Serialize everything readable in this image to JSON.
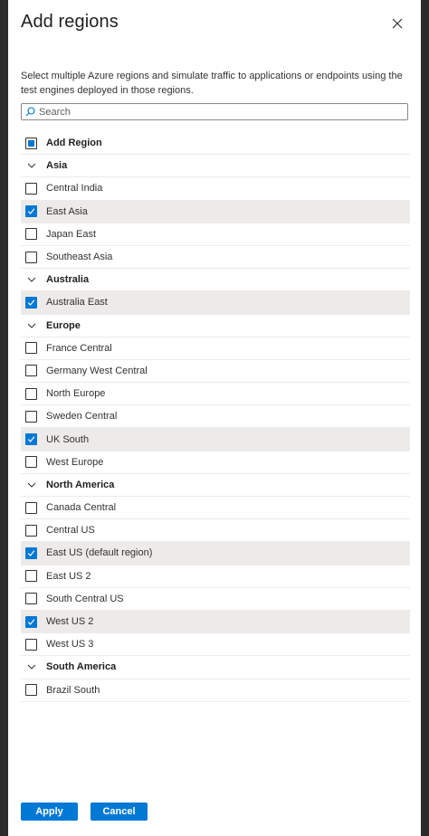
{
  "panel": {
    "title": "Add regions",
    "description": "Select multiple Azure regions and simulate traffic to applications or endpoints using the test engines deployed in those regions."
  },
  "search": {
    "placeholder": "Search",
    "value": ""
  },
  "list": {
    "header_label": "Add Region",
    "groups": [
      {
        "name": "Asia",
        "regions": [
          {
            "label": "Central India",
            "checked": false
          },
          {
            "label": "East Asia",
            "checked": true
          },
          {
            "label": "Japan East",
            "checked": false
          },
          {
            "label": "Southeast Asia",
            "checked": false
          }
        ]
      },
      {
        "name": "Australia",
        "regions": [
          {
            "label": "Australia East",
            "checked": true
          }
        ]
      },
      {
        "name": "Europe",
        "regions": [
          {
            "label": "France Central",
            "checked": false
          },
          {
            "label": "Germany West Central",
            "checked": false
          },
          {
            "label": "North Europe",
            "checked": false
          },
          {
            "label": "Sweden Central",
            "checked": false
          },
          {
            "label": "UK South",
            "checked": true
          },
          {
            "label": "West Europe",
            "checked": false
          }
        ]
      },
      {
        "name": "North America",
        "regions": [
          {
            "label": "Canada Central",
            "checked": false
          },
          {
            "label": "Central US",
            "checked": false
          },
          {
            "label": "East US (default region)",
            "checked": true
          },
          {
            "label": "East US 2",
            "checked": false
          },
          {
            "label": "South Central US",
            "checked": false
          },
          {
            "label": "West US 2",
            "checked": true
          },
          {
            "label": "West US 3",
            "checked": false
          }
        ]
      },
      {
        "name": "South America",
        "regions": [
          {
            "label": "Brazil South",
            "checked": false
          }
        ]
      }
    ]
  },
  "footer": {
    "apply_label": "Apply",
    "cancel_label": "Cancel"
  },
  "colors": {
    "accent": "#0078d4",
    "selected_row": "#edebe9"
  }
}
